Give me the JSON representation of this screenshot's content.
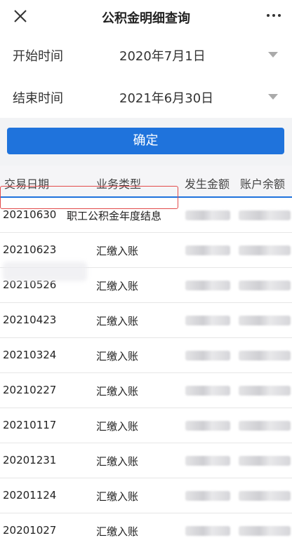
{
  "header": {
    "title": "公积金明细查询"
  },
  "filters": {
    "start_label": "开始时间",
    "start_value": "2020年7月1日",
    "end_label": "结束时间",
    "end_value": "2021年6月30日"
  },
  "confirm_label": "确定",
  "table": {
    "columns": [
      "交易日期",
      "业务类型",
      "发生金额",
      "账户余额"
    ],
    "rows": [
      {
        "date": "20210630",
        "type": "职工公积金年度结息"
      },
      {
        "date": "20210623",
        "type": "汇缴入账"
      },
      {
        "date": "20210526",
        "type": "汇缴入账"
      },
      {
        "date": "20210423",
        "type": "汇缴入账"
      },
      {
        "date": "20210324",
        "type": "汇缴入账"
      },
      {
        "date": "20210227",
        "type": "汇缴入账"
      },
      {
        "date": "20210117",
        "type": "汇缴入账"
      },
      {
        "date": "20201231",
        "type": "汇缴入账"
      },
      {
        "date": "20201124",
        "type": "汇缴入账"
      },
      {
        "date": "20201027",
        "type": "汇缴入账"
      }
    ]
  },
  "colors": {
    "accent": "#1f73dc",
    "highlight": "#e24a4a"
  }
}
